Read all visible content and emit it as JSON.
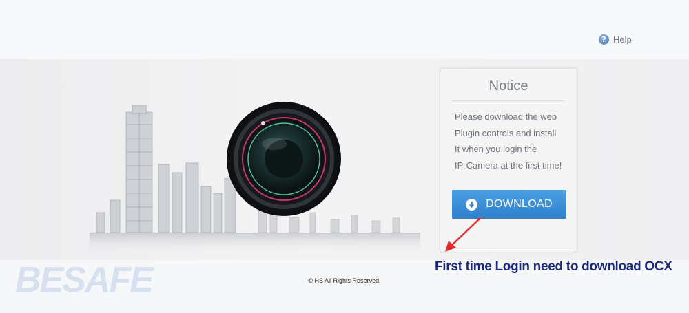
{
  "header": {
    "help_label": "Help",
    "help_icon": "help-circle-icon"
  },
  "notice": {
    "title": "Notice",
    "lines": [
      "Please download the web",
      "Plugin controls and install",
      "It when you login the",
      "IP-Camera at the first time!"
    ],
    "download_label": "DOWNLOAD",
    "download_icon": "download-arrow-icon"
  },
  "annotation": {
    "text": "First time Login need to download OCX",
    "color": "#1b2a7a",
    "arrow_color": "#e32b2b"
  },
  "footer": {
    "copyright": "©  HS  All Rights Reserved."
  },
  "watermark": {
    "text": "BESAFE"
  },
  "colors": {
    "button": "#3a8ad6",
    "help_icon": "#4a78b8"
  }
}
